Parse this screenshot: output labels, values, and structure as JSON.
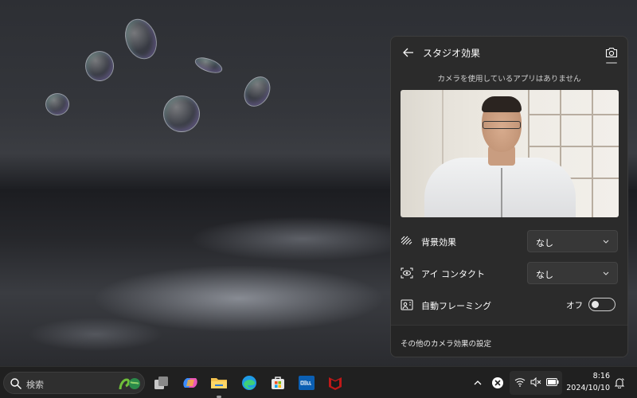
{
  "panel": {
    "title": "スタジオ効果",
    "status_message": "カメラを使用しているアプリはありません",
    "rows": [
      {
        "label": "背景効果",
        "value": "なし"
      },
      {
        "label": "アイ コンタクト",
        "value": "なし"
      },
      {
        "label": "自動フレーミング",
        "toggle_label": "オフ",
        "toggle_on": false
      }
    ],
    "footer_link": "その他のカメラ効果の設定"
  },
  "taskbar": {
    "search_placeholder": "検索",
    "apps": [
      "task-view",
      "copilot",
      "file-explorer",
      "edge",
      "microsoft-store",
      "dell",
      "mcafee"
    ],
    "clock": {
      "time": "8:16",
      "date": "2024/10/10"
    }
  },
  "colors": {
    "panel_bg": "#2b2b2b",
    "taskbar_bg": "#202020",
    "dropdown_bg": "#373737"
  }
}
